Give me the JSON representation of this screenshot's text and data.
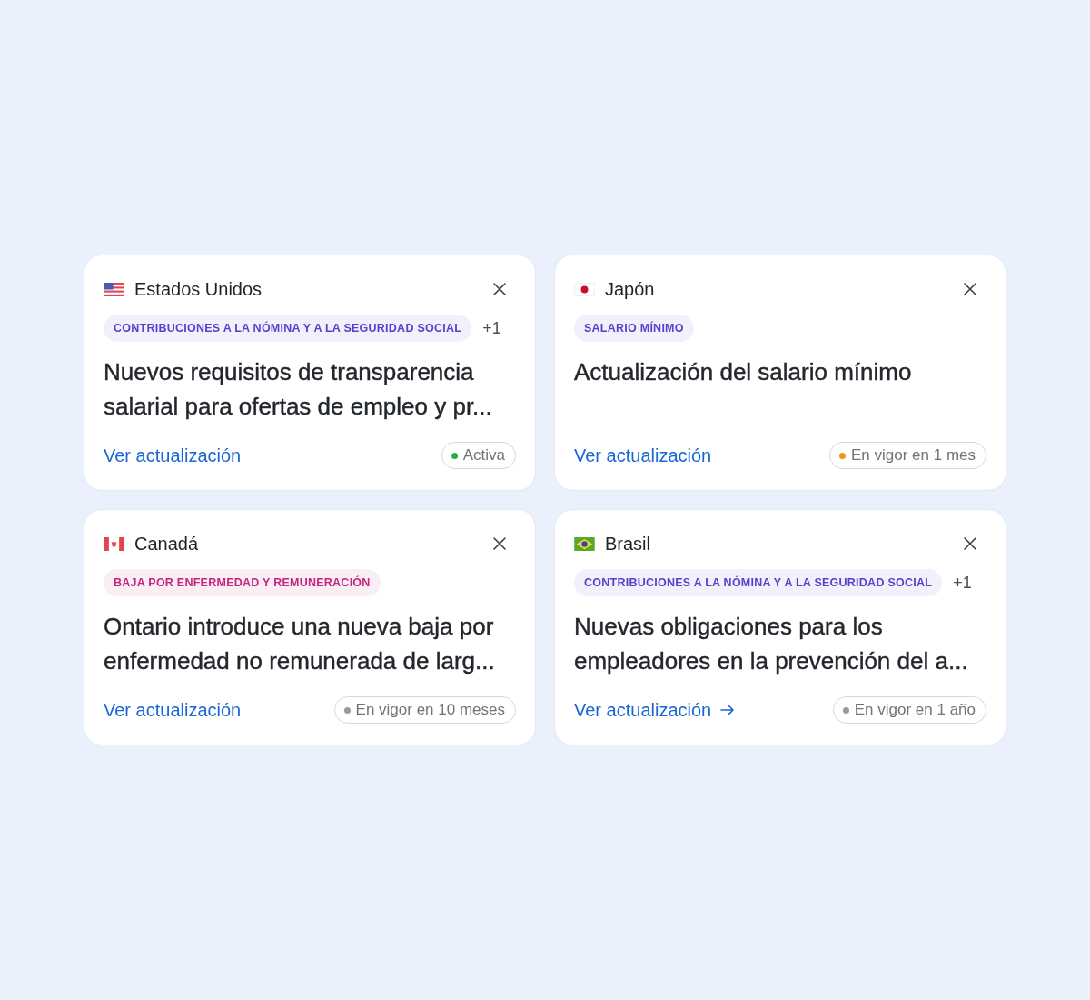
{
  "cards": [
    {
      "flag": {
        "kind": "us"
      },
      "country": "Estados Unidos",
      "tag": {
        "text": "CONTRIBUCIONES A LA NÓMINA Y A LA SEGURIDAD SOCIAL",
        "color": "#5a3fcf"
      },
      "extra_tags": "+1",
      "title": "Nuevos requisitos de transparencia salarial para ofertas de empleo y pr...",
      "link": {
        "text": "Ver actualización",
        "hovered": false
      },
      "status": {
        "text": "Activa",
        "color": "#23b04a"
      }
    },
    {
      "flag": {
        "kind": "jp"
      },
      "country": "Japón",
      "tag": {
        "text": "SALARIO MÍNIMO",
        "color": "#5a3fcf"
      },
      "title": "Actualización del salario mínimo",
      "link": {
        "text": "Ver actualización",
        "hovered": false
      },
      "status": {
        "text": "En vigor en 1 mes",
        "color": "#f0960e"
      }
    },
    {
      "flag": {
        "kind": "ca"
      },
      "country": "Canadá",
      "tag": {
        "text": "BAJA POR ENFERMEDAD Y REMUNERACIÓN",
        "color": "#c4267f"
      },
      "title": "Ontario introduce una nueva baja por enfermedad no remunerada de larg...",
      "link": {
        "text": "Ver actualización",
        "hovered": false
      },
      "status": {
        "text": "En vigor en 10 meses",
        "color": "#9a9a9a"
      }
    },
    {
      "flag": {
        "kind": "br"
      },
      "country": "Brasil",
      "tag": {
        "text": "CONTRIBUCIONES A LA NÓMINA Y A LA SEGURIDAD SOCIAL",
        "color": "#5a3fcf"
      },
      "extra_tags": "+1",
      "title": "Nuevas obligaciones para los empleadores en la prevención del a...",
      "link": {
        "text": "Ver actualización",
        "hovered": true
      },
      "status": {
        "text": "En vigor en 1 año",
        "color": "#9a9a9a"
      }
    }
  ]
}
